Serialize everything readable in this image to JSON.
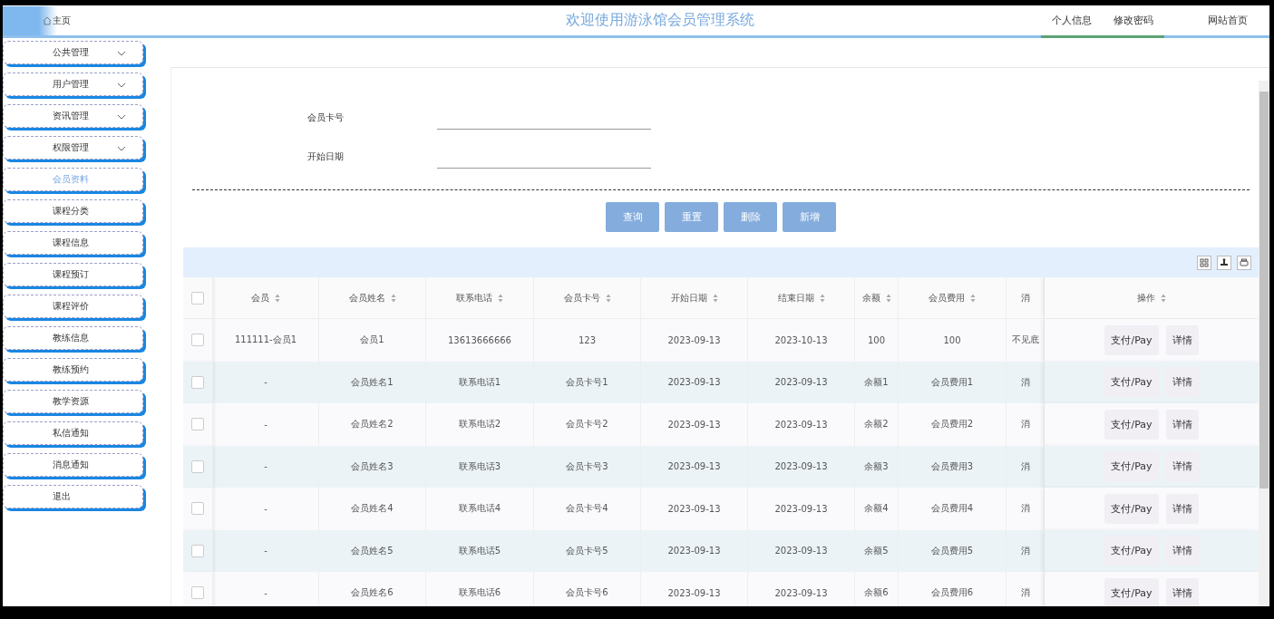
{
  "header": {
    "home": "主页",
    "title": "欢迎使用游泳馆会员管理系统",
    "links": [
      {
        "label": "个人信息",
        "selected": true
      },
      {
        "label": "修改密码",
        "selected": true
      },
      {
        "label": "网站首页",
        "selected": false
      }
    ]
  },
  "sidebar": {
    "items": [
      {
        "label": "公共管理",
        "expandable": true,
        "selected": false
      },
      {
        "label": "用户管理",
        "expandable": true,
        "selected": false
      },
      {
        "label": "资讯管理",
        "expandable": true,
        "selected": false
      },
      {
        "label": "权限管理",
        "expandable": true,
        "selected": false
      },
      {
        "label": "会员资料",
        "expandable": false,
        "selected": true
      },
      {
        "label": "课程分类",
        "expandable": false,
        "selected": false
      },
      {
        "label": "课程信息",
        "expandable": false,
        "selected": false
      },
      {
        "label": "课程预订",
        "expandable": false,
        "selected": false
      },
      {
        "label": "课程评价",
        "expandable": false,
        "selected": false
      },
      {
        "label": "教练信息",
        "expandable": false,
        "selected": false
      },
      {
        "label": "教练预约",
        "expandable": false,
        "selected": false
      },
      {
        "label": "教学资源",
        "expandable": false,
        "selected": false
      },
      {
        "label": "私信通知",
        "expandable": false,
        "selected": false
      },
      {
        "label": "消息通知",
        "expandable": false,
        "selected": false
      },
      {
        "label": "退出",
        "expandable": false,
        "selected": false
      }
    ]
  },
  "search": {
    "fields": [
      {
        "label": "会员卡号"
      },
      {
        "label": "开始日期"
      }
    ],
    "buttons": [
      "查询",
      "重置",
      "删除",
      "新增"
    ]
  },
  "table": {
    "select_all_checked": false,
    "columns": [
      {
        "label": "会员",
        "sortable": true
      },
      {
        "label": "会员姓名",
        "sortable": true
      },
      {
        "label": "联系电话",
        "sortable": true
      },
      {
        "label": "会员卡号",
        "sortable": true
      },
      {
        "label": "开始日期",
        "sortable": true
      },
      {
        "label": "结束日期",
        "sortable": true
      },
      {
        "label": "余额",
        "sortable": true
      },
      {
        "label": "会员费用",
        "sortable": true
      },
      {
        "label": "消",
        "sortable": false
      },
      {
        "label": "操作",
        "sortable": true
      }
    ],
    "rows": [
      {
        "checked": false,
        "cells": [
          "111111-会员1",
          "会员1",
          "13613666666",
          "123",
          "2023-09-13",
          "2023-10-13",
          "100",
          "100",
          "不见底"
        ],
        "actions": [
          "支付/Pay",
          "详情"
        ]
      },
      {
        "checked": false,
        "cells": [
          "-",
          "会员姓名1",
          "联系电话1",
          "会员卡号1",
          "2023-09-13",
          "2023-09-13",
          "余额1",
          "会员费用1",
          "消"
        ],
        "actions": [
          "支付/Pay",
          "详情"
        ]
      },
      {
        "checked": false,
        "cells": [
          "-",
          "会员姓名2",
          "联系电话2",
          "会员卡号2",
          "2023-09-13",
          "2023-09-13",
          "余额2",
          "会员费用2",
          "消"
        ],
        "actions": [
          "支付/Pay",
          "详情"
        ]
      },
      {
        "checked": false,
        "cells": [
          "-",
          "会员姓名3",
          "联系电话3",
          "会员卡号3",
          "2023-09-13",
          "2023-09-13",
          "余额3",
          "会员费用3",
          "消"
        ],
        "actions": [
          "支付/Pay",
          "详情"
        ]
      },
      {
        "checked": false,
        "cells": [
          "-",
          "会员姓名4",
          "联系电话4",
          "会员卡号4",
          "2023-09-13",
          "2023-09-13",
          "余额4",
          "会员费用4",
          "消"
        ],
        "actions": [
          "支付/Pay",
          "详情"
        ]
      },
      {
        "checked": false,
        "cells": [
          "-",
          "会员姓名5",
          "联系电话5",
          "会员卡号5",
          "2023-09-13",
          "2023-09-13",
          "余额5",
          "会员费用5",
          "消"
        ],
        "actions": [
          "支付/Pay",
          "详情"
        ]
      },
      {
        "checked": false,
        "cells": [
          "-",
          "会员姓名6",
          "联系电话6",
          "会员卡号6",
          "2023-09-13",
          "2023-09-13",
          "余额6",
          "会员费用6",
          "消"
        ],
        "actions": [
          "支付/Pay",
          "详情"
        ]
      }
    ]
  }
}
